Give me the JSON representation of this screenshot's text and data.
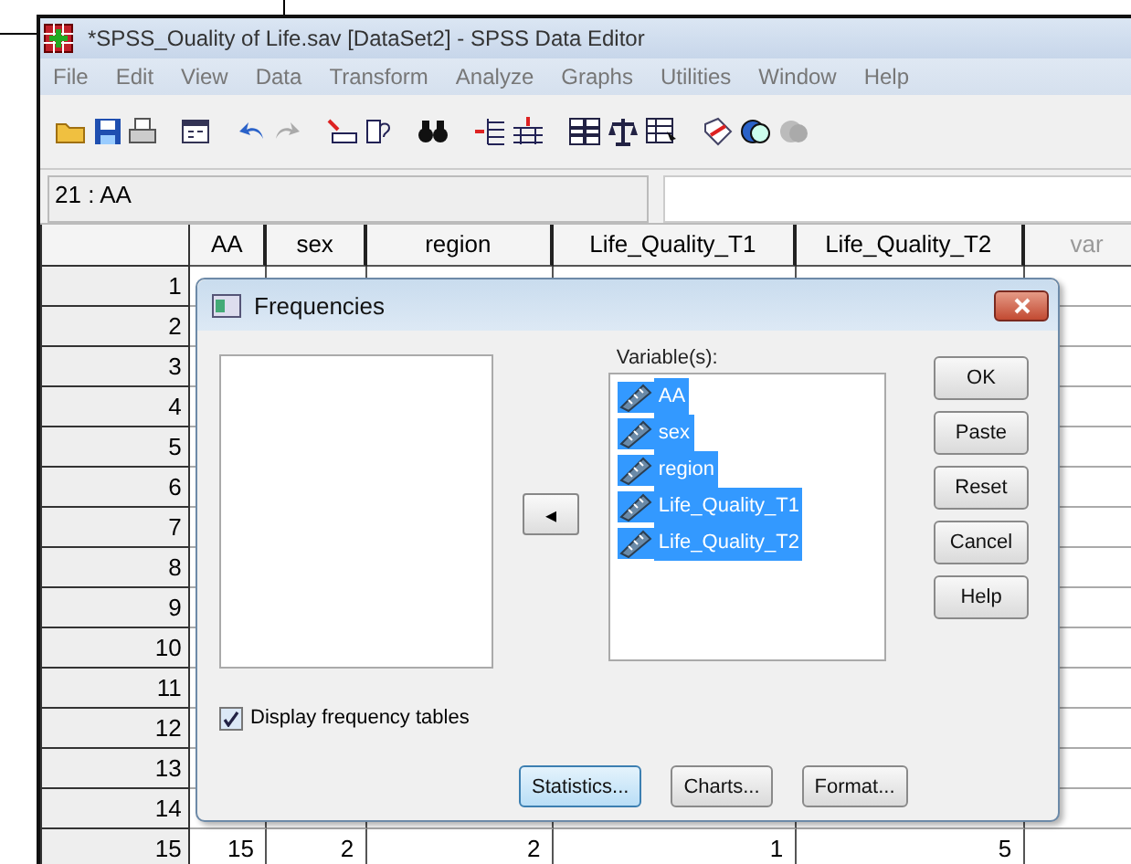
{
  "window": {
    "title": "*SPSS_Ouality of Life.sav [DataSet2] - SPSS Data Editor"
  },
  "menu": [
    "File",
    "Edit",
    "View",
    "Data",
    "Transform",
    "Analyze",
    "Graphs",
    "Utilities",
    "Window",
    "Help"
  ],
  "cell_ref": "21 : AA",
  "table": {
    "columns": [
      {
        "label": "AA",
        "kind": "var"
      },
      {
        "label": "sex",
        "kind": "var"
      },
      {
        "label": "region",
        "kind": "var"
      },
      {
        "label": "Life_Quality_T1",
        "kind": "var"
      },
      {
        "label": "Life_Quality_T2",
        "kind": "var"
      },
      {
        "label": "var",
        "kind": "empty"
      }
    ],
    "rows": [
      {
        "number": "1",
        "cells": []
      },
      {
        "number": "2",
        "cells": []
      },
      {
        "number": "3",
        "cells": []
      },
      {
        "number": "4",
        "cells": []
      },
      {
        "number": "5",
        "cells": []
      },
      {
        "number": "6",
        "cells": []
      },
      {
        "number": "7",
        "cells": []
      },
      {
        "number": "8",
        "cells": []
      },
      {
        "number": "9",
        "cells": []
      },
      {
        "number": "10",
        "cells": []
      },
      {
        "number": "11",
        "cells": []
      },
      {
        "number": "12",
        "cells": []
      },
      {
        "number": "13",
        "cells": []
      },
      {
        "number": "14",
        "cells": []
      },
      {
        "number": "15",
        "cells": [
          "15",
          "2",
          "2",
          "1",
          "5"
        ]
      }
    ]
  },
  "dialog": {
    "title": "Frequencies",
    "variables_label": "Variable(s):",
    "variables": [
      {
        "name": "AA",
        "selected": true
      },
      {
        "name": "sex",
        "selected": true
      },
      {
        "name": "region",
        "selected": true
      },
      {
        "name": "Life_Quality_T1",
        "selected": true
      },
      {
        "name": "Life_Quality_T2",
        "selected": true
      }
    ],
    "move_button": "◂",
    "side_buttons": [
      "OK",
      "Paste",
      "Reset",
      "Cancel",
      "Help"
    ],
    "checkbox": {
      "label": "Display frequency tables",
      "checked": true
    },
    "bottom_buttons": [
      {
        "label": "Statistics...",
        "focused": true
      },
      {
        "label": "Charts...",
        "focused": false
      },
      {
        "label": "Format...",
        "focused": false
      }
    ]
  }
}
